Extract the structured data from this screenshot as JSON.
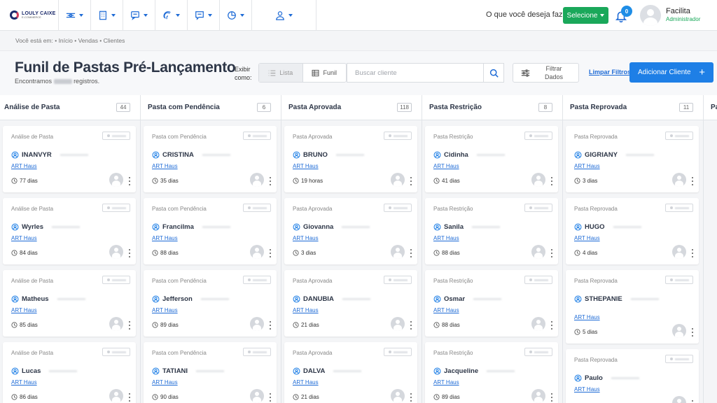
{
  "brand": {
    "name": "LOULY CAIXE",
    "tagline": "E-COMMERCE"
  },
  "nav": [
    {
      "name": "nav-funnel",
      "icon": "funnel-lines-icon"
    },
    {
      "name": "nav-building",
      "icon": "building-icon"
    },
    {
      "name": "nav-messages",
      "icon": "message-icon"
    },
    {
      "name": "nav-fingerprint",
      "icon": "fingerprint-icon"
    },
    {
      "name": "nav-chat",
      "icon": "chat-icon"
    },
    {
      "name": "nav-reports",
      "icon": "pie-chart-icon"
    },
    {
      "name": "nav-users",
      "icon": "user-icon"
    }
  ],
  "header": {
    "ask_text": "O que você deseja fazer?",
    "select_label": "Selecione",
    "notifications_count": "0",
    "user_name": "Facilita",
    "user_role": "Administrador"
  },
  "breadcrumb": "Você está em: • Início • Vendas • Clientes",
  "page": {
    "title": "Funil de Pastas Pré-Lançamento",
    "found_prefix": "Encontramos",
    "found_suffix": "registros.",
    "exibir_label": "Exibir como:",
    "view_list": "Lista",
    "view_funnel": "Funil",
    "search_placeholder": "Buscar cliente",
    "filter_label": "Filtrar Dados",
    "clear_filters": "Limpar Filtros",
    "add_client": "Adicionar Cliente"
  },
  "columns": [
    {
      "title": "Análise de Pasta",
      "count": "44",
      "cards": [
        {
          "stage": "Análise de Pasta",
          "name": "INANVYR",
          "company": "ART Haus",
          "time": "77 dias"
        },
        {
          "stage": "Análise de Pasta",
          "name": "Wyrles",
          "company": "ART Haus",
          "time": "84 dias"
        },
        {
          "stage": "Análise de Pasta",
          "name": "Matheus",
          "company": "ART Haus",
          "time": "85 dias"
        },
        {
          "stage": "Análise de Pasta",
          "name": "Lucas",
          "company": "ART Haus",
          "time": "86 dias"
        }
      ]
    },
    {
      "title": "Pasta com Pendência",
      "count": "6",
      "cards": [
        {
          "stage": "Pasta com Pendência",
          "name": "CRISTINA",
          "company": "ART Haus",
          "time": "35 dias"
        },
        {
          "stage": "Pasta com Pendência",
          "name": "Francilma",
          "company": "ART Haus",
          "time": "88 dias"
        },
        {
          "stage": "Pasta com Pendência",
          "name": "Jefferson",
          "company": "ART Haus",
          "time": "89 dias"
        },
        {
          "stage": "Pasta com Pendência",
          "name": "TATIANI",
          "company": "ART Haus",
          "time": "90 dias"
        }
      ]
    },
    {
      "title": "Pasta Aprovada",
      "count": "118",
      "cards": [
        {
          "stage": "Pasta Aprovada",
          "name": "BRUNO",
          "company": "ART Haus",
          "time": "19 horas"
        },
        {
          "stage": "Pasta Aprovada",
          "name": "Giovanna",
          "company": "ART Haus",
          "time": "3 dias"
        },
        {
          "stage": "Pasta Aprovada",
          "name": "DANUBIA",
          "company": "ART Haus",
          "time": "21 dias"
        },
        {
          "stage": "Pasta Aprovada",
          "name": "DALVA",
          "company": "ART Haus",
          "time": "21 dias"
        }
      ]
    },
    {
      "title": "Pasta Restrição",
      "count": "8",
      "cards": [
        {
          "stage": "Pasta Restrição",
          "name": "Cidinha",
          "company": "ART Haus",
          "time": "41 dias"
        },
        {
          "stage": "Pasta Restrição",
          "name": "Sanila",
          "company": "ART Haus",
          "time": "88 dias"
        },
        {
          "stage": "Pasta Restrição",
          "name": "Osmar",
          "company": "ART Haus",
          "time": "88 dias"
        },
        {
          "stage": "Pasta Restrição",
          "name": "Jacqueline",
          "company": "ART Haus",
          "time": "89 dias"
        }
      ]
    },
    {
      "title": "Pasta Reprovada",
      "count": "11",
      "cards": [
        {
          "stage": "Pasta Reprovada",
          "name": "GIGRIANY",
          "company": "ART Haus",
          "time": "3 dias"
        },
        {
          "stage": "Pasta Reprovada",
          "name": "HUGO",
          "company": "ART Haus",
          "time": "4 dias"
        },
        {
          "stage": "Pasta Reprovada",
          "name": "STHEPANIE",
          "company": "ART Haus",
          "time": "5 dias",
          "tall": true
        },
        {
          "stage": "Pasta Reprovada",
          "name": "Paulo",
          "company": "ART Haus",
          "time": ""
        }
      ]
    },
    {
      "title": "Pa",
      "count": "",
      "cards": []
    }
  ]
}
